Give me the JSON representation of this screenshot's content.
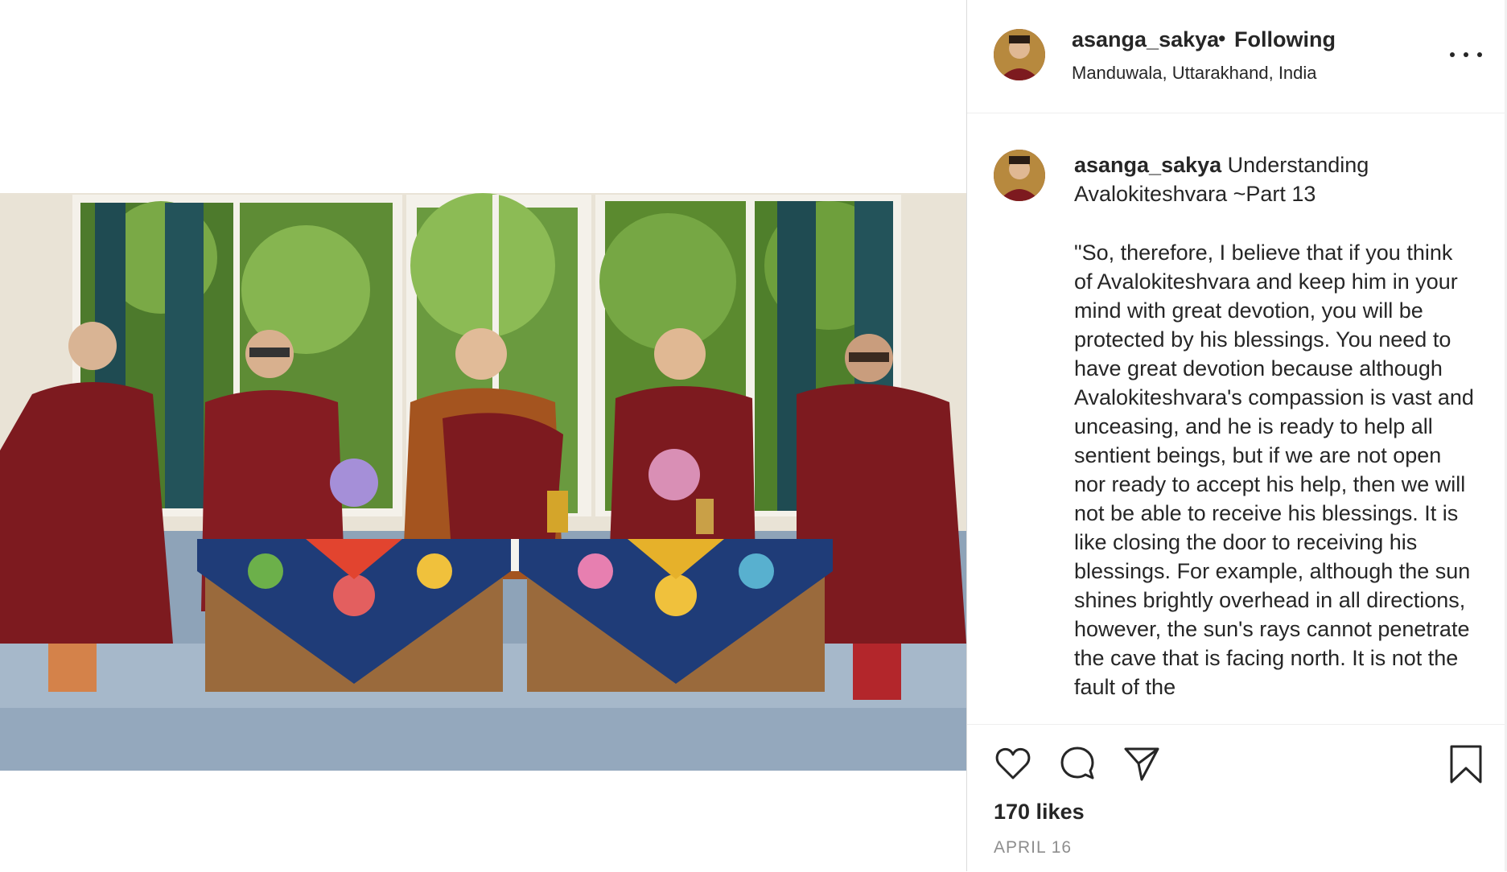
{
  "post": {
    "username": "asanga_sakya",
    "separator_dot": "•",
    "follow_status": "Following",
    "location": "Manduwala, Uttarakhand, India",
    "more_icon": "more-horizontal-icon"
  },
  "caption": {
    "username": "asanga_sakya",
    "title": "Understanding Avalokiteshvara ~Part 13",
    "body": "\"So, therefore, I believe that if you think of Avalokiteshvara and keep him in your mind with great devotion, you will be protected by his blessings. You need to have great devotion because although Avalokiteshvara's compassion is vast and unceasing, and he is ready to help all sentient beings, but if we are not open nor ready to accept his help, then we will not be able to receive his blessings. It is like closing the door to receiving his blessings. For example, although the sun shines brightly overhead in all directions, however, the sun's rays cannot penetrate the cave that is facing north. It is not the fault of the"
  },
  "actions": {
    "like_icon": "heart-icon",
    "comment_icon": "comment-icon",
    "share_icon": "share-icon",
    "save_icon": "bookmark-icon"
  },
  "stats": {
    "likes": "170 likes",
    "date": "APRIL 16"
  },
  "colors": {
    "robe": "#7d1a1f",
    "border": "#dbdbdb",
    "muted_text": "#8e8e8e"
  }
}
